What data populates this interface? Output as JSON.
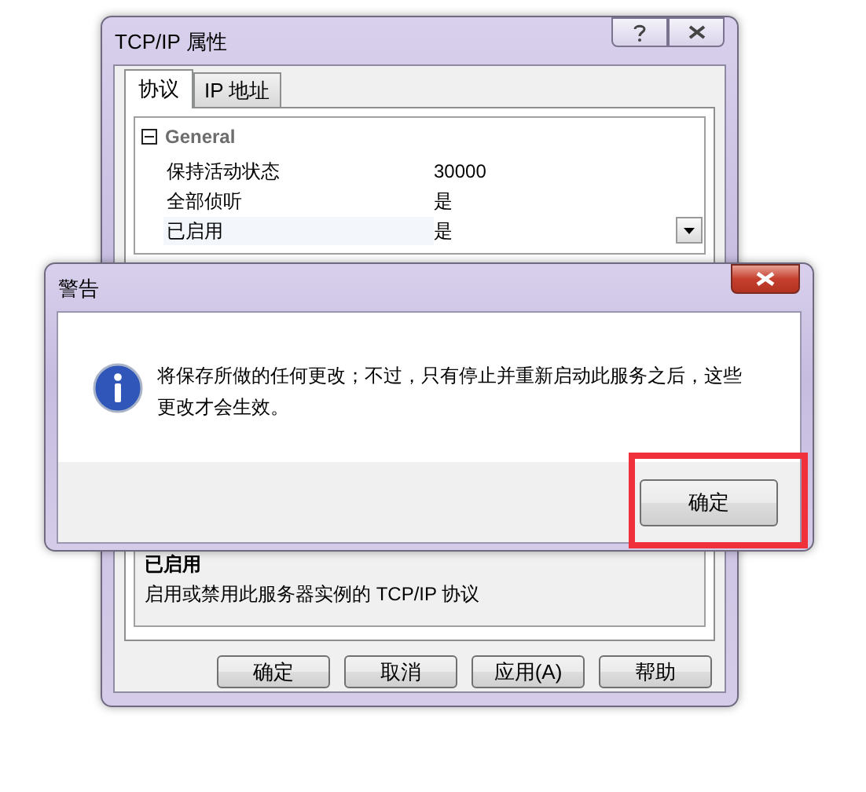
{
  "window": {
    "title": "TCP/IP 属性",
    "tabs": [
      {
        "label": "协议",
        "selected": true
      },
      {
        "label": "IP 地址",
        "selected": false
      }
    ],
    "property_grid": {
      "category": "General",
      "expanded": true,
      "rows": [
        {
          "name": "保持活动状态",
          "value": "30000",
          "selected": false
        },
        {
          "name": "全部侦听",
          "value": "是",
          "selected": false
        },
        {
          "name": "已启用",
          "value": "是",
          "selected": true
        }
      ]
    },
    "description": {
      "title": "已启用",
      "text": "启用或禁用此服务器实例的 TCP/IP 协议"
    },
    "buttons": [
      "确定",
      "取消",
      "应用(A)",
      "帮助"
    ]
  },
  "alert": {
    "title": "警告",
    "message": "将保存所做的任何更改；不过，只有停止并重新启动此服务之后，这些更改才会生效。",
    "button": "确定",
    "highlighted": true
  }
}
